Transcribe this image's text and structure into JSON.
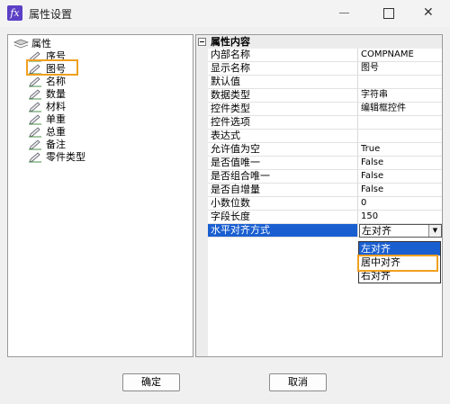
{
  "window": {
    "title": "属性设置"
  },
  "tree": {
    "root_label": "属性",
    "items": [
      {
        "label": "序号"
      },
      {
        "label": "图号"
      },
      {
        "label": "名称"
      },
      {
        "label": "数量"
      },
      {
        "label": "材料"
      },
      {
        "label": "单重"
      },
      {
        "label": "总重"
      },
      {
        "label": "备注"
      },
      {
        "label": "零件类型"
      }
    ],
    "selected_index": 1
  },
  "grid": {
    "group_title": "属性内容",
    "rows": [
      {
        "name": "内部名称",
        "value": "COMPNAME"
      },
      {
        "name": "显示名称",
        "value": "图号"
      },
      {
        "name": "默认值",
        "value": ""
      },
      {
        "name": "数据类型",
        "value": "字符串"
      },
      {
        "name": "控件类型",
        "value": "编辑框控件"
      },
      {
        "name": "控件选项",
        "value": ""
      },
      {
        "name": "表达式",
        "value": ""
      },
      {
        "name": "允许值为空",
        "value": "True"
      },
      {
        "name": "是否值唯一",
        "value": "False"
      },
      {
        "name": "是否组合唯一",
        "value": "False"
      },
      {
        "name": "是否自增量",
        "value": "False"
      },
      {
        "name": "小数位数",
        "value": "0"
      },
      {
        "name": "字段长度",
        "value": "150"
      }
    ],
    "selected_row": {
      "name": "水平对齐方式",
      "value": "左对齐"
    }
  },
  "dropdown": {
    "options": [
      "左对齐",
      "居中对齐",
      "右对齐"
    ],
    "hovered_index": 0,
    "highlighted_index": 1
  },
  "buttons": {
    "ok_label": "确定",
    "cancel_label": "取消"
  },
  "colors": {
    "selection": "#1a5fd0",
    "annotation_highlight": "#f0a020",
    "app_icon": "#5b3fc5"
  }
}
